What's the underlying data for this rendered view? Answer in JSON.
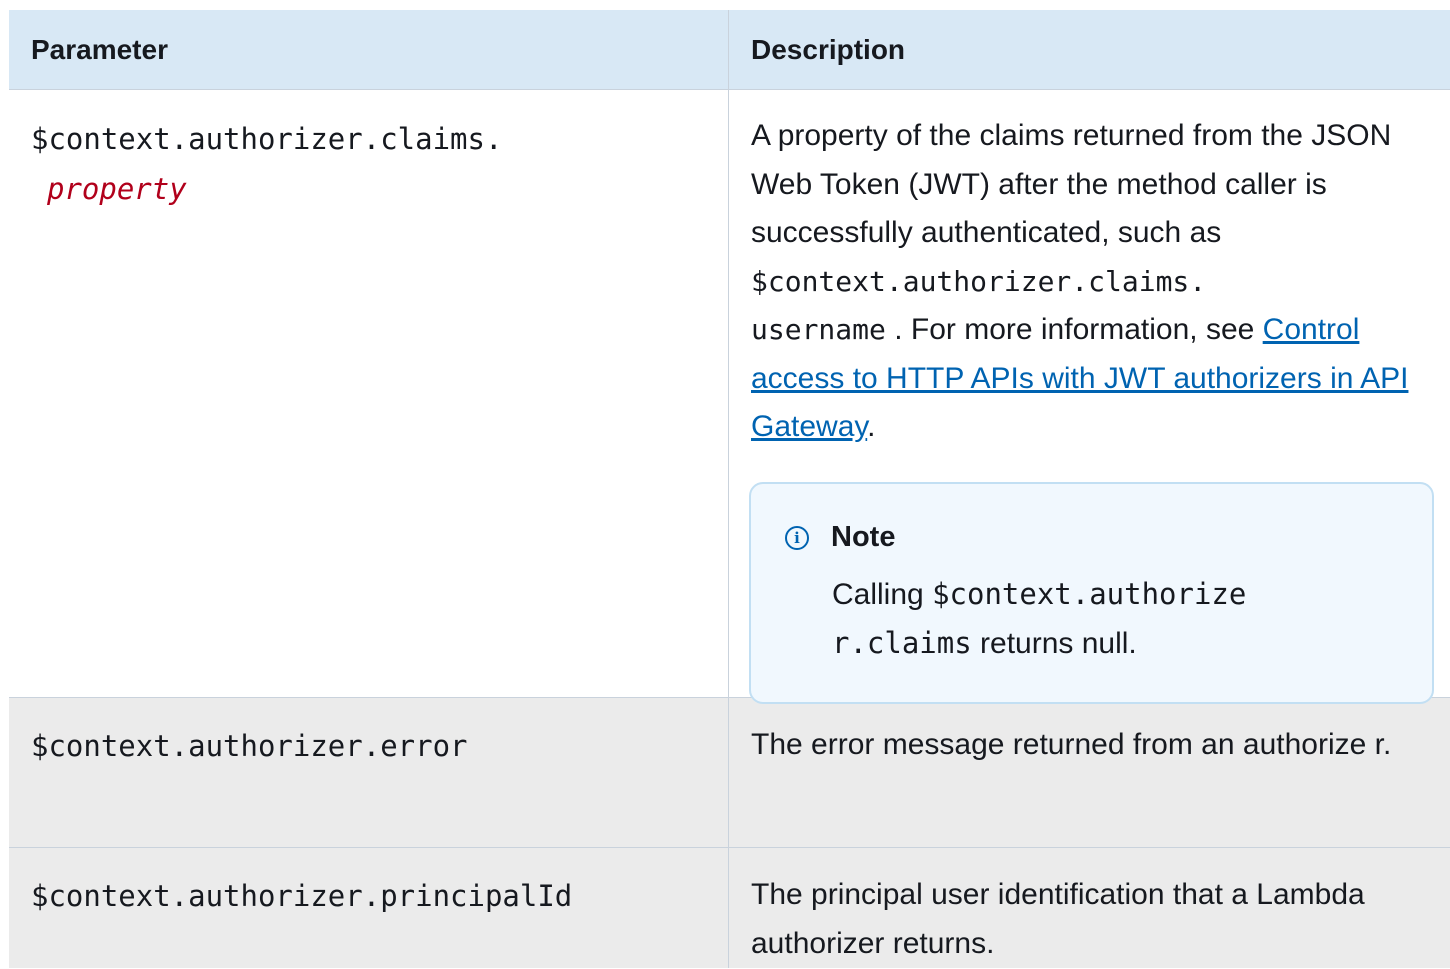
{
  "table": {
    "headers": {
      "parameter": "Parameter",
      "description": "Description"
    },
    "rows": [
      {
        "param_line1": "$context.authorizer.claims.",
        "param_var": "property",
        "desc": {
          "t1": "A property of the claims returned from the JSON Web Token (JWT) after the method caller is successfully authenticated, such as ",
          "code1": "$context.authorizer.claims.",
          "code2": "username",
          "t2": " . For more information, see ",
          "link": "Control access to HTTP APIs with JWT authorizers in API Gateway",
          "t3": "."
        },
        "note": {
          "title": "Note",
          "t1": "Calling ",
          "code1": "$context.authorize",
          "code2": "r.claims",
          "t2": " returns null."
        }
      },
      {
        "param": "$context.authorizer.error",
        "desc": "The error message returned from an authorize r."
      },
      {
        "param": "$context.authorizer.principalId",
        "desc": "The principal user identification that a Lambda authorizer returns."
      }
    ]
  }
}
